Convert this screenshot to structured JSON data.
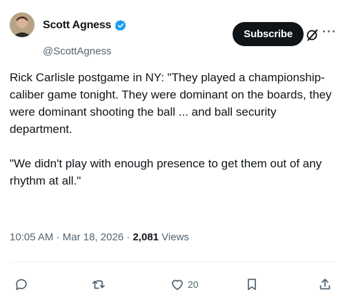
{
  "author": {
    "display_name": "Scott Agness",
    "handle": "@ScottAgness"
  },
  "header": {
    "subscribe_label": "Subscribe",
    "more_label": "···"
  },
  "tweet": {
    "paragraph1": "Rick Carlisle postgame in NY: \"They played a championship-caliber game tonight. They were dominant on the boards, they were dominant shooting the ball ... and ball security department.",
    "paragraph2": "\"We didn't play with enough presence to get them out of any rhythm at all.\""
  },
  "meta": {
    "time": "10:05 AM",
    "sep1": " · ",
    "date": "Mar 18, 2026",
    "sep2": " · ",
    "views_count": "2,081",
    "views_label": " Views"
  },
  "actions": {
    "reply_count": "",
    "retweet_count": "",
    "like_count": "20",
    "bookmark_count": "",
    "share_count": ""
  },
  "colors": {
    "text": "#0f1419",
    "secondary": "#536471",
    "verified": "#1d9bf0",
    "button_bg": "#0f1419"
  },
  "icons": {
    "verified": "verified-badge-icon",
    "grok": "grok-icon",
    "reply": "reply-icon",
    "retweet": "retweet-icon",
    "like": "heart-icon",
    "bookmark": "bookmark-icon",
    "share": "share-icon"
  }
}
